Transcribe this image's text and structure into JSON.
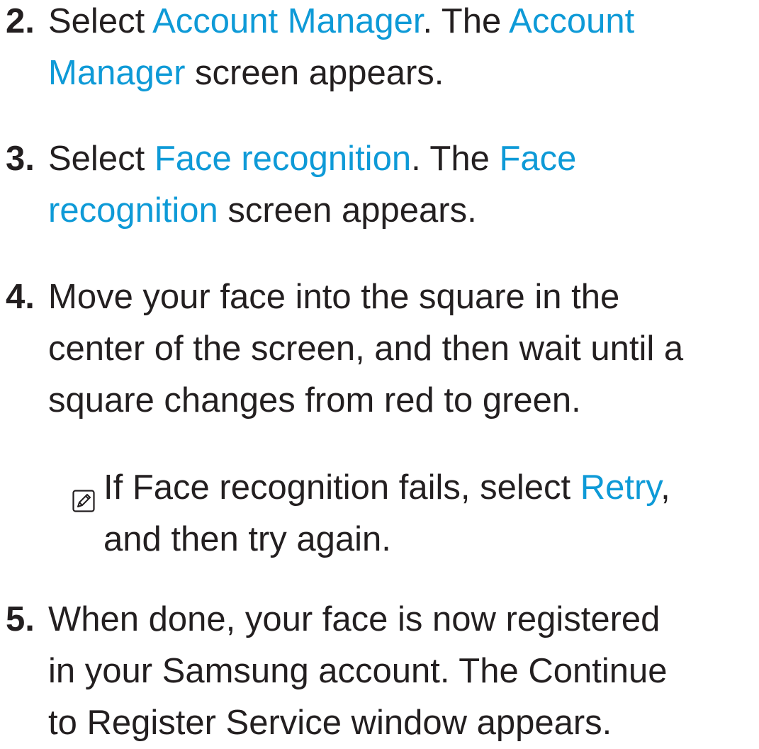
{
  "steps": [
    {
      "number": "2.",
      "line1": [
        "Select ",
        "Account Manager",
        ". The ",
        "Account"
      ],
      "line2": [
        "Manager",
        " screen appears."
      ]
    },
    {
      "number": "3.",
      "line1": [
        "Select ",
        "Face recognition",
        ". The ",
        "Face"
      ],
      "line2": [
        "recognition",
        " screen appears."
      ]
    },
    {
      "number": "4.",
      "lines": [
        "Move your face into the square in the",
        "center of the screen, and then wait until a",
        "square changes from red to green."
      ]
    },
    {
      "number": "5.",
      "lines": [
        "When done, your face is now registered",
        "in your Samsung account. The Continue",
        "to Register Service window appears."
      ]
    }
  ],
  "note": {
    "icon": "note-pencil-icon",
    "line1": [
      "If Face recognition fails, select ",
      "Retry",
      ","
    ],
    "line2": "and then try again."
  },
  "colors": {
    "text": "#231f20",
    "highlight": "#0e9ad7"
  }
}
